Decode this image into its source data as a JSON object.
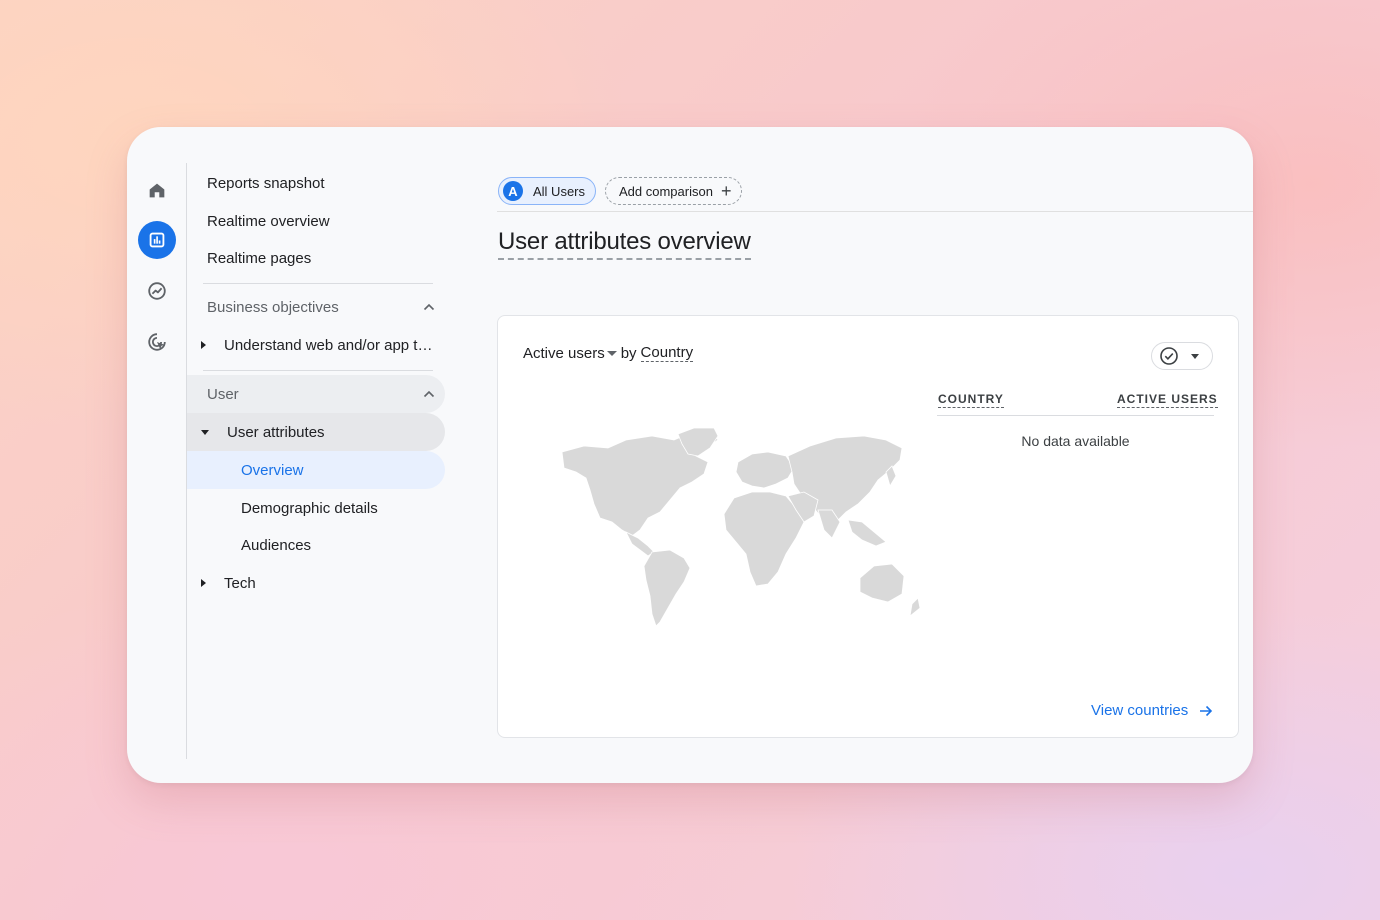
{
  "rail": {
    "icons": [
      "home-icon",
      "reports-icon",
      "explore-icon",
      "advertising-icon"
    ],
    "active_color": "#1a73e8"
  },
  "nav": {
    "top_items": [
      {
        "label": "Reports snapshot"
      },
      {
        "label": "Realtime overview"
      },
      {
        "label": "Realtime pages"
      }
    ],
    "business_objectives": {
      "label": "Business objectives",
      "children": [
        {
          "label": "Understand web and/or app t…"
        }
      ]
    },
    "user": {
      "label": "User",
      "user_attributes": {
        "label": "User attributes",
        "children": [
          {
            "label": "Overview",
            "selected": true
          },
          {
            "label": "Demographic details"
          },
          {
            "label": "Audiences"
          }
        ]
      },
      "tech": {
        "label": "Tech"
      }
    }
  },
  "main": {
    "comparison": {
      "all_users": {
        "avatar": "A",
        "label": "All Users"
      },
      "add_comparison": {
        "label": "Add comparison",
        "icon": "plus-icon"
      }
    },
    "title": "User attributes overview",
    "card": {
      "metric": "Active users",
      "by": "by",
      "dimension": "Country",
      "columns": [
        "COUNTRY",
        "ACTIVE USERS"
      ],
      "empty_text": "No data available",
      "link": "View countries"
    }
  },
  "colors": {
    "accent": "#1a73e8",
    "selected_bg": "#e8f0fe",
    "map_fill": "#d9d9d9"
  }
}
